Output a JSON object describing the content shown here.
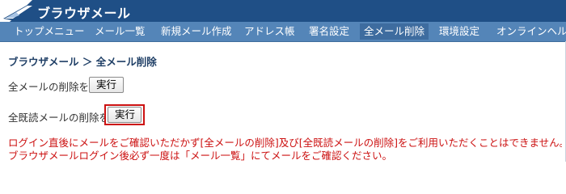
{
  "app": {
    "title": "ブラウザメール"
  },
  "nav": {
    "items": [
      {
        "label": "トップメニュー",
        "active": false
      },
      {
        "label": "メール一覧",
        "active": false
      },
      {
        "label": "新規メール作成",
        "active": false
      },
      {
        "label": "アドレス帳",
        "active": false
      },
      {
        "label": "署名設定",
        "active": false
      },
      {
        "label": "全メール削除",
        "active": true
      },
      {
        "label": "環境設定",
        "active": false
      },
      {
        "label": "オンラインヘルプ",
        "active": false
      }
    ]
  },
  "breadcrumb": "ブラウザメール ＞ 全メール削除",
  "actions": [
    {
      "label": "全メールの削除を",
      "button": "実行",
      "highlighted": false
    },
    {
      "label": "全既読メールの削除を",
      "button": "実行",
      "highlighted": true
    }
  ],
  "notice": {
    "lines": [
      "ログイン直後にメールをご確認いただかず[全メールの削除]及び[全既読メールの削除]をご利用いただくことはできません。",
      "ブラウザメールログイン後必ず一度は「メール一覧」にてメールをご確認ください。"
    ]
  },
  "colors": {
    "header_bg": "#1f4f86",
    "nav_bg": "#5485b8",
    "nav_active_bg": "#3e6c9f",
    "notice_text": "#cc1111",
    "highlight_border": "#cc1111"
  }
}
